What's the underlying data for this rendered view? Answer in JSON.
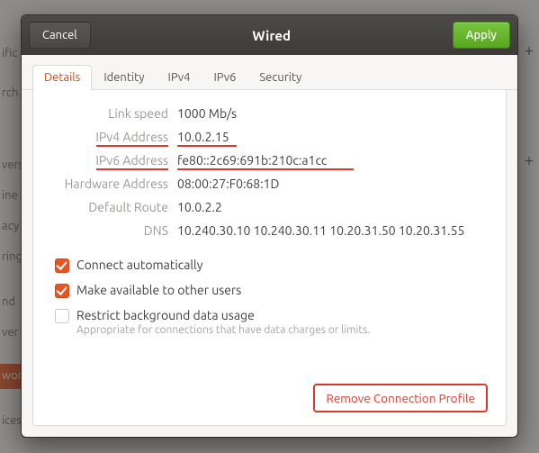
{
  "background": {
    "side_labels": [
      "ific",
      "rch",
      "vers",
      "ine",
      "acy",
      "ring",
      "nd",
      "ver",
      "wor",
      "ices"
    ],
    "highlight_index": 8
  },
  "dialog": {
    "title": "Wired",
    "cancel": "Cancel",
    "apply": "Apply"
  },
  "tabs": [
    "Details",
    "Identity",
    "IPv4",
    "IPv6",
    "Security"
  ],
  "active_tab_index": 0,
  "details": {
    "link_speed_label": "Link speed",
    "link_speed_value": "1000 Mb/s",
    "ipv4_label": "IPv4 Address",
    "ipv4_value": "10.0.2.15",
    "ipv6_label": "IPv6 Address",
    "ipv6_value": "fe80::2c69:691b:210c:a1cc",
    "hw_label": "Hardware Address",
    "hw_value": "08:00:27:F0:68:1D",
    "route_label": "Default Route",
    "route_value": "10.0.2.2",
    "dns_label": "DNS",
    "dns_value": "10.240.30.10 10.240.30.11 10.20.31.50 10.20.31.55"
  },
  "checks": {
    "auto_label": "Connect automatically",
    "auto_checked": true,
    "share_label": "Make available to other users",
    "share_checked": true,
    "restrict_label": "Restrict background data usage",
    "restrict_sub": "Appropriate for connections that have data charges or limits.",
    "restrict_checked": false
  },
  "footer": {
    "remove_label": "Remove Connection Profile"
  },
  "annotations": {
    "ipv4_underlined": true,
    "ipv6_underlined": true
  }
}
